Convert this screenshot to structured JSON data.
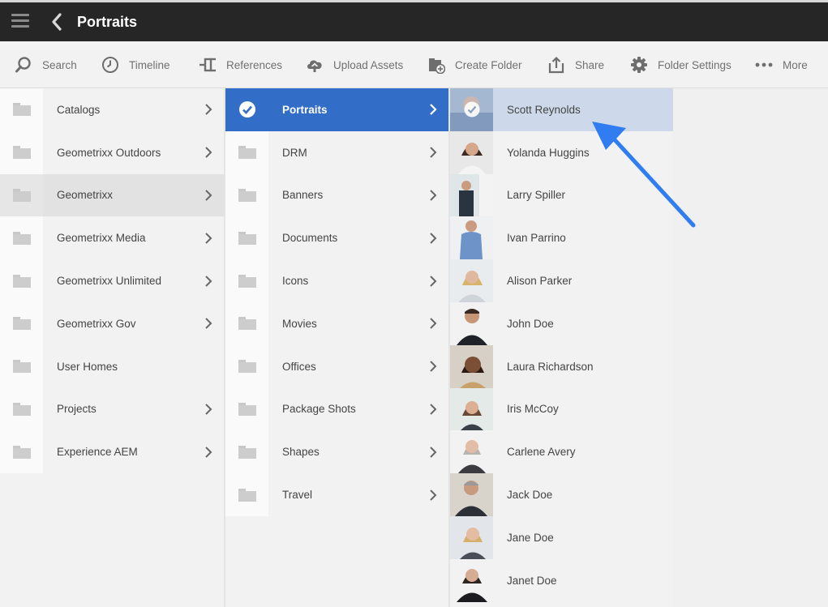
{
  "header": {
    "title": "Portraits"
  },
  "toolbar": {
    "items": [
      {
        "label": "Search"
      },
      {
        "label": "Timeline"
      },
      {
        "label": "References"
      },
      {
        "label": "Upload Assets"
      },
      {
        "label": "Create Folder"
      },
      {
        "label": "Share"
      },
      {
        "label": "Folder Settings"
      },
      {
        "label": "More"
      }
    ]
  },
  "columns": {
    "root": {
      "items": [
        {
          "label": "Catalogs"
        },
        {
          "label": "Geometrixx Outdoors"
        },
        {
          "label": "Geometrixx"
        },
        {
          "label": "Geometrixx Media"
        },
        {
          "label": "Geometrixx Unlimited"
        },
        {
          "label": "Geometrixx Gov"
        },
        {
          "label": "User Homes"
        },
        {
          "label": "Projects"
        },
        {
          "label": "Experience AEM"
        }
      ],
      "highlighted": "Geometrixx"
    },
    "geometrixx": {
      "items": [
        {
          "label": "Portraits"
        },
        {
          "label": "DRM"
        },
        {
          "label": "Banners"
        },
        {
          "label": "Documents"
        },
        {
          "label": "Icons"
        },
        {
          "label": "Movies"
        },
        {
          "label": "Offices"
        },
        {
          "label": "Package Shots"
        },
        {
          "label": "Shapes"
        },
        {
          "label": "Travel"
        }
      ],
      "selected": "Portraits"
    },
    "portraits": {
      "items": [
        {
          "label": "Scott Reynolds"
        },
        {
          "label": "Yolanda Huggins"
        },
        {
          "label": "Larry Spiller"
        },
        {
          "label": "Ivan Parrino"
        },
        {
          "label": "Alison Parker"
        },
        {
          "label": "John Doe"
        },
        {
          "label": "Laura Richardson"
        },
        {
          "label": "Iris McCoy"
        },
        {
          "label": "Carlene Avery"
        },
        {
          "label": "Jack Doe"
        },
        {
          "label": "Jane Doe"
        },
        {
          "label": "Janet Doe"
        }
      ],
      "selected": "Scott Reynolds"
    }
  },
  "colors": {
    "topbar": "#262626",
    "selection_blue": "#326ec8",
    "selection_light": "#cdd9ea",
    "annotation_arrow": "#2f7df0"
  }
}
